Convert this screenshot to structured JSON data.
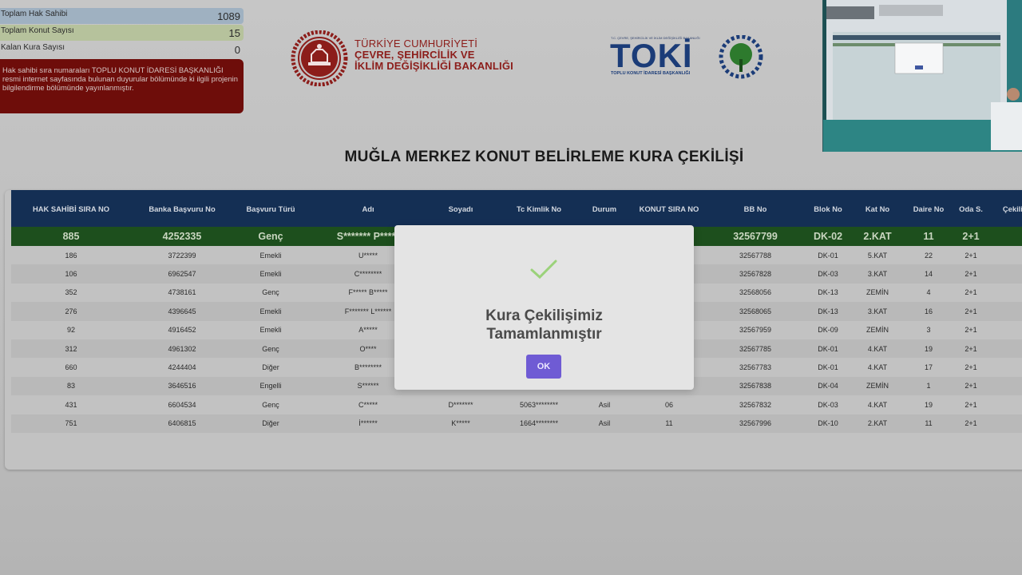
{
  "stats": {
    "total_right_holders_label": "Toplam Hak Sahibi",
    "total_right_holders_value": "1089",
    "total_housing_label": "Toplam Konut Sayısı",
    "total_housing_value": "15",
    "remaining_draws_label": "Kalan Kura Sayısı",
    "remaining_draws_value": "0",
    "info_text": "Hak sahibi sıra numaraları TOPLU KONUT İDARESİ BAŞKANLIĞI resmi internet sayfasında bulunan duyurular bölümünde ki ilgili projenin bilgilendirme bölümünde yayınlanmıştır."
  },
  "ministry": {
    "line1": "TÜRKİYE CUMHURİYETİ",
    "line2": "ÇEVRE, ŞEHİRCİLİK VE",
    "line3": "İKLİM DEĞİŞİKLİĞİ BAKANLIĞI"
  },
  "toki": {
    "small": "T.C. ÇEVRE, ŞEHİRCİLİK VE İKLİM DEĞİŞİKLİĞİ BAKANLIĞI",
    "word": "TOKİ",
    "sub": "TOPLU KONUT İDARESİ BAŞKANLIĞI"
  },
  "page_title": "MUĞLA MERKEZ KONUT BELİRLEME KURA ÇEKİLİŞİ",
  "table": {
    "headers": [
      "HAK SAHİBİ SIRA NO",
      "Banka Başvuru No",
      "Başvuru Türü",
      "Adı",
      "Soyadı",
      "Tc Kimlik No",
      "Durum",
      "KONUT SIRA NO",
      "BB No",
      "Blok No",
      "Kat No",
      "Daire No",
      "Oda S.",
      "Çekiliş"
    ],
    "winner": [
      "885",
      "4252335",
      "Genç",
      "S******* P*****",
      "",
      "",
      "",
      "",
      "32567799",
      "DK-02",
      "2.KAT",
      "11",
      "2+1",
      ""
    ],
    "rows": [
      [
        "186",
        "3722399",
        "Emekli",
        "U*****",
        "",
        "",
        "",
        "",
        "32567788",
        "DK-01",
        "5.KAT",
        "22",
        "2+1",
        ""
      ],
      [
        "106",
        "6962547",
        "Emekli",
        "C********",
        "",
        "",
        "",
        "",
        "32567828",
        "DK-03",
        "3.KAT",
        "14",
        "2+1",
        ""
      ],
      [
        "352",
        "4738161",
        "Genç",
        "F***** B*****",
        "",
        "",
        "",
        "",
        "32568056",
        "DK-13",
        "ZEMİN",
        "4",
        "2+1",
        ""
      ],
      [
        "276",
        "4396645",
        "Emekli",
        "F******* L******",
        "",
        "",
        "",
        "",
        "32568065",
        "DK-13",
        "3.KAT",
        "16",
        "2+1",
        ""
      ],
      [
        "92",
        "4916452",
        "Emekli",
        "A*****",
        "",
        "",
        "",
        "",
        "32567959",
        "DK-09",
        "ZEMİN",
        "3",
        "2+1",
        ""
      ],
      [
        "312",
        "4961302",
        "Genç",
        "O****",
        "",
        "",
        "",
        "",
        "32567785",
        "DK-01",
        "4.KAT",
        "19",
        "2+1",
        ""
      ],
      [
        "660",
        "4244404",
        "Diğer",
        "B********",
        "",
        "",
        "",
        "",
        "32567783",
        "DK-01",
        "4.KAT",
        "17",
        "2+1",
        ""
      ],
      [
        "83",
        "3646516",
        "Engelli",
        "S******",
        "",
        "",
        "",
        "",
        "32567838",
        "DK-04",
        "ZEMİN",
        "1",
        "2+1",
        ""
      ],
      [
        "431",
        "6604534",
        "Genç",
        "C*****",
        "D*******",
        "5063********",
        "Asil",
        "06",
        "32567832",
        "DK-03",
        "4.KAT",
        "19",
        "2+1",
        ""
      ],
      [
        "751",
        "6406815",
        "Diğer",
        "İ******",
        "K*****",
        "1664********",
        "Asil",
        "11",
        "32567996",
        "DK-10",
        "2.KAT",
        "11",
        "2+1",
        ""
      ]
    ]
  },
  "dialog": {
    "message_line1": "Kura Çekilişimiz",
    "message_line2": "Tamamlanmıştır",
    "ok_label": "OK"
  },
  "colors": {
    "header_bg": "#142f54",
    "winner_bg": "#1d4f1d",
    "info_bg": "#6e0d0a",
    "ok_button": "#6f5bd4",
    "check": "#9bd27a"
  }
}
